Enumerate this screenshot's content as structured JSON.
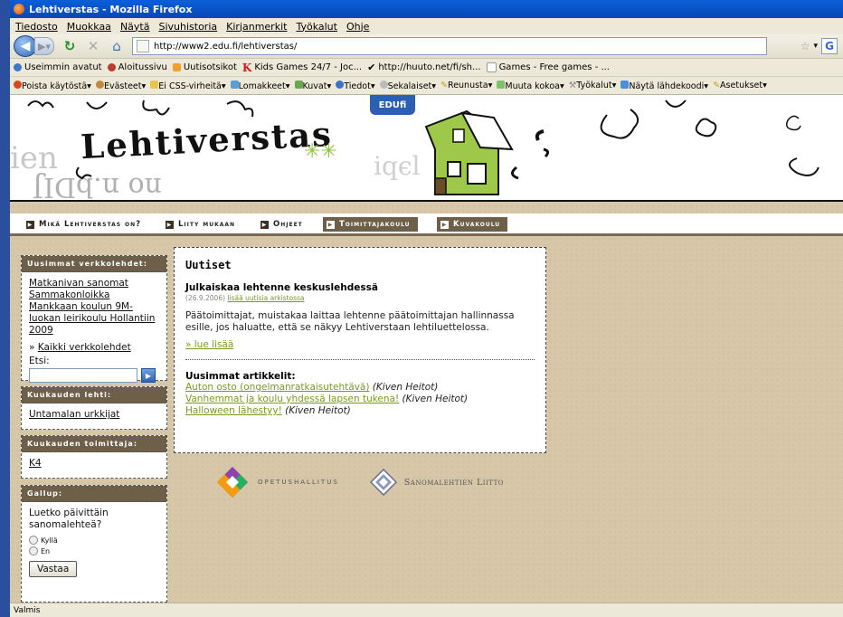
{
  "window": {
    "title": "Lehtiverstas - Mozilla Firefox"
  },
  "menubar": [
    "Tiedosto",
    "Muokkaa",
    "Näytä",
    "Sivuhistoria",
    "Kirjanmerkit",
    "Työkalut",
    "Ohje"
  ],
  "navbar": {
    "url": "http://www2.edu.fi/lehtiverstas/"
  },
  "bookmarks": [
    "Useimmin avatut",
    "Aloitussivu",
    "Uutisotsikot",
    "Kids Games 24/7 - Joc...",
    "http://huuto.net/fi/sh...",
    "Games - Free games - ..."
  ],
  "webdev_toolbar": [
    "Poista käytöstä",
    "Evästeet",
    "Ei CSS-virheitä",
    "Lomakkeet",
    "Kuvat",
    "Tiedot",
    "Sekalaiset",
    "Reunusta",
    "Muuta kokoa",
    "Työkalut",
    "Näytä lähdekoodi",
    "Asetukset"
  ],
  "site": {
    "title": "Lehtiverstas",
    "edu_logo": "EDUfi",
    "menu": [
      "Mikä Lehtiverstas on?",
      "Liity mukaan",
      "Ohjeet",
      "Toimittajakoulu",
      "Kuvakoulu"
    ],
    "sidebar": {
      "latest": {
        "heading": "Uusimmat verkkolehdet:",
        "items": [
          "Matkanivan sanomat",
          "Sammakonloikka",
          "Mankkaan koulun 9M-luokan leirikoulu Hollantiin 2009"
        ],
        "all_link": "Kaikki verkkolehdet",
        "all_prefix": "»",
        "search_label": "Etsi:"
      },
      "month_paper": {
        "heading": "Kuukauden lehti:",
        "item": "Untamalan urkkijat"
      },
      "month_editor": {
        "heading": "Kuukauden toimittaja:",
        "item": "K4"
      },
      "poll": {
        "heading": "Gallup:",
        "question": "Luetko päivittäin sanomalehteä?",
        "options": [
          "Kyllä",
          "En"
        ],
        "button": "Vastaa"
      }
    },
    "news": {
      "heading": "Uutiset",
      "headline": "Julkaiskaa lehtenne keskuslehdessä",
      "date": "(26.9.2006)",
      "archive_link": "lisää uutisia arkistossa",
      "body": "Päätoimittajat, muistakaa laittaa lehtenne päätoimittajan hallinnassa esille, jos haluatte, että se näkyy Lehtiverstaan lehtiluettelossa.",
      "read_more": "» lue lisää",
      "articles_heading": "Uusimmat artikkelit:",
      "articles": [
        {
          "title": "Auton osto (ongelmanratkaisutehtävä)",
          "author": "(Kiven Heitot)"
        },
        {
          "title": "Vanhemmat ja koulu yhdessä lapsen tukena!",
          "author": "(Kiven Heitot)"
        },
        {
          "title": "Halloween lähestyy!",
          "author": "(Kiven Heitot)"
        }
      ]
    },
    "partners": [
      "OPETUSHALLITUS",
      "Sanomalehtien Liitto"
    ]
  },
  "status": "Valmis"
}
